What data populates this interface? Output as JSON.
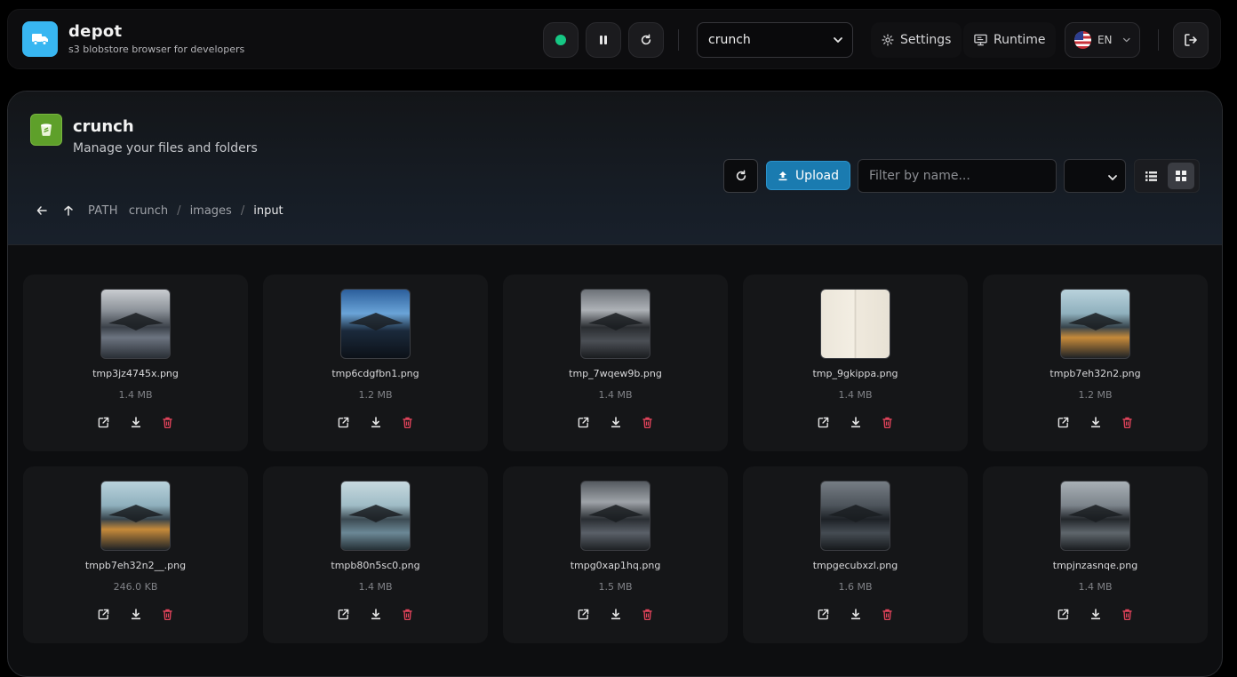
{
  "app": {
    "title": "depot",
    "subtitle": "s3 blobstore browser for developers"
  },
  "topbar": {
    "status_color": "#16c784",
    "bucket_selected": "crunch",
    "settings_label": "Settings",
    "runtime_label": "Runtime",
    "language_label": "EN"
  },
  "header": {
    "title": "crunch",
    "subtitle": "Manage your files and folders",
    "upload_label": "Upload",
    "filter_placeholder": "Filter by name..."
  },
  "breadcrumb": {
    "label": "PATH",
    "segments": [
      "crunch",
      "images",
      "input"
    ]
  },
  "files": [
    {
      "name": "tmp3jz4745x.png",
      "size": "1.4 MB",
      "thumb": "storm"
    },
    {
      "name": "tmp6cdgfbn1.png",
      "size": "1.2 MB",
      "thumb": "bluesky"
    },
    {
      "name": "tmp_7wqew9b.png",
      "size": "1.4 MB",
      "thumb": "hangar"
    },
    {
      "name": "tmp_9gkippa.png",
      "size": "1.4 MB",
      "thumb": "paper"
    },
    {
      "name": "tmpb7eh32n2.png",
      "size": "1.2 MB",
      "thumb": "lights"
    },
    {
      "name": "tmpb7eh32n2__.png",
      "size": "246.0 KB",
      "thumb": "lights"
    },
    {
      "name": "tmpb80n5sc0.png",
      "size": "1.4 MB",
      "thumb": "teal"
    },
    {
      "name": "tmpg0xap1hq.png",
      "size": "1.5 MB",
      "thumb": "hangar2"
    },
    {
      "name": "tmpgecubxzl.png",
      "size": "1.6 MB",
      "thumb": "dark"
    },
    {
      "name": "tmpjnzasnqe.png",
      "size": "1.4 MB",
      "thumb": "grey"
    }
  ],
  "colors": {
    "accent": "#1a7bb0",
    "logo": "#38b6f1",
    "bucket_icon": "#5ea02a",
    "delete": "#e0435a"
  }
}
